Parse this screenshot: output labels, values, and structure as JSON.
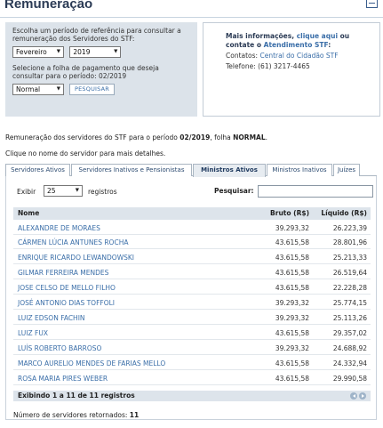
{
  "header": {
    "title": "Remuneração"
  },
  "filter": {
    "intro": "Escolha um período de referência para consultar a remuneração dos Servidores do STF:",
    "month": "Fevereiro",
    "year": "2019",
    "sheet_prompt": "Selecione a folha de pagamento que deseja consultar para o período: 02/2019",
    "sheet": "Normal",
    "search_button": "PESQUISAR"
  },
  "info": {
    "heading_prefix": "Mais informações, ",
    "link_click": "clique aqui",
    "heading_or": " ou",
    "line2_prefix": "contate o ",
    "link_atendimento": "Atendimento STF",
    "line2_suffix": ":",
    "contacts_label": "Contatos: ",
    "contacts_link": "Central do Cidadão STF",
    "phone": "Telefone: (61) 3217-4465"
  },
  "summary": {
    "prefix": "Remuneração dos servidores do STF para o período ",
    "period": "02/2019",
    "middle": ", folha ",
    "sheet": "NORMAL",
    "suffix": "."
  },
  "hint": "Clique no nome do servidor para mais detalhes.",
  "tabs": [
    {
      "label": "Servidores Ativos",
      "active": false
    },
    {
      "label": "Servidores Inativos e Pensionistas",
      "active": false
    },
    {
      "label": "Ministros Ativos",
      "active": true
    },
    {
      "label": "Ministros Inativos",
      "active": false
    },
    {
      "label": "Juízes",
      "active": false
    }
  ],
  "table_controls": {
    "show_label": "Exibir",
    "page_size": "25",
    "records_label": "registros",
    "search_label": "Pesquisar:",
    "search_value": ""
  },
  "table": {
    "headers": [
      "Nome",
      "Bruto (R$)",
      "Líquido (R$)"
    ],
    "rows": [
      [
        "ALEXANDRE DE MORAES",
        "39.293,32",
        "26.223,39"
      ],
      [
        "CÁRMEN LÚCIA ANTUNES ROCHA",
        "43.615,58",
        "28.801,96"
      ],
      [
        "ENRIQUE RICARDO LEWANDOWSKI",
        "43.615,58",
        "25.213,33"
      ],
      [
        "GILMAR FERREIRA MENDES",
        "43.615,58",
        "26.519,64"
      ],
      [
        "JOSE CELSO DE MELLO FILHO",
        "43.615,58",
        "22.228,28"
      ],
      [
        "JOSÉ ANTONIO DIAS TOFFOLI",
        "39.293,32",
        "25.774,15"
      ],
      [
        "LUIZ EDSON FACHIN",
        "39.293,32",
        "25.113,26"
      ],
      [
        "LUIZ FUX",
        "43.615,58",
        "29.357,02"
      ],
      [
        "LUÍS ROBERTO BARROSO",
        "39.293,32",
        "24.688,92"
      ],
      [
        "MARCO AURELIO MENDES DE FARIAS MELLO",
        "43.615,58",
        "24.332,94"
      ],
      [
        "ROSA MARIA PIRES WEBER",
        "43.615,58",
        "29.990,58"
      ]
    ],
    "footer_info": "Exibindo 1 a 11 de 11 registros"
  },
  "count": {
    "label": "Número de servidores retornados: ",
    "value": "11"
  }
}
